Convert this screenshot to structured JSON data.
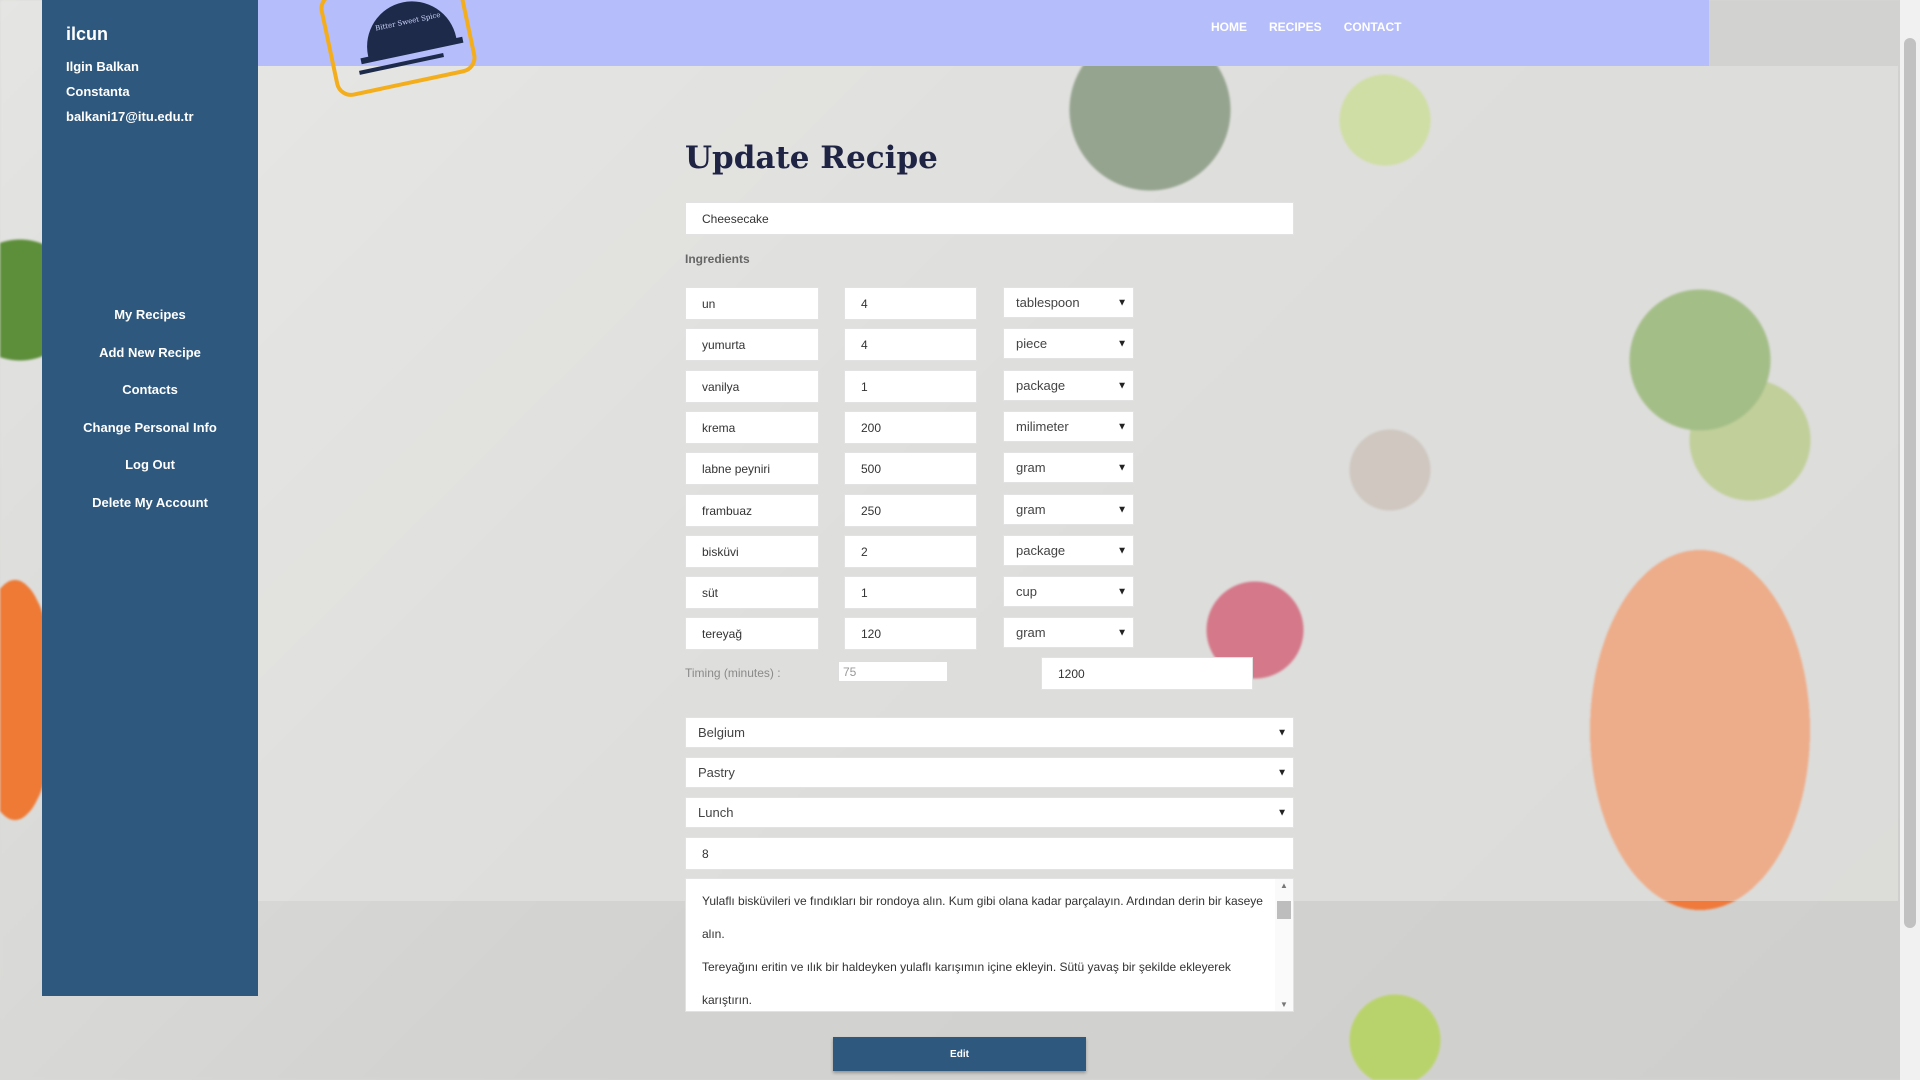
{
  "sidebar": {
    "username": "ilcun",
    "full_name": "Ilgin Balkan",
    "city": "Constanta",
    "email": "balkani17@itu.edu.tr",
    "menu": [
      "My Recipes",
      "Add New Recipe",
      "Contacts",
      "Change Personal Info",
      "Log Out",
      "Delete My Account"
    ]
  },
  "nav": {
    "logo_text": "Bitter Sweet Spice",
    "links": [
      "HOME",
      "RECIPES",
      "CONTACT"
    ]
  },
  "form": {
    "title": "Update Recipe",
    "recipe_name": "Cheesecake",
    "ingredients_label": "Ingredients",
    "ingredients": [
      {
        "name": "un",
        "amount": "4",
        "unit": "tablespoon"
      },
      {
        "name": "yumurta",
        "amount": "4",
        "unit": "piece"
      },
      {
        "name": "vanilya",
        "amount": "1",
        "unit": "package"
      },
      {
        "name": "krema",
        "amount": "200",
        "unit": "milimeter"
      },
      {
        "name": "labne peyniri",
        "amount": "500",
        "unit": "gram"
      },
      {
        "name": "frambuaz",
        "amount": "250",
        "unit": "gram"
      },
      {
        "name": "bisküvi",
        "amount": "2",
        "unit": "package"
      },
      {
        "name": "süt",
        "amount": "1",
        "unit": "cup"
      },
      {
        "name": "tereyağ",
        "amount": "120",
        "unit": "gram"
      }
    ],
    "timing_label": "Timing (minutes) :",
    "timing_value": "75",
    "calories_value": "1200",
    "country": "Belgium",
    "category": "Pastry",
    "meal": "Lunch",
    "servings": "8",
    "instructions": [
      "Yulaflı bisküvileri ve fındıkları bir rondoya alın. Kum gibi olana kadar parçalayın. Ardından derin bir kaseye",
      "alın.",
      "Tereyağını eritin ve ılık bir haldeyken yulaflı karışımın içine ekleyin. Sütü yavaş bir şekilde ekleyerek",
      "karıştırın."
    ],
    "submit_label": "Edit"
  }
}
